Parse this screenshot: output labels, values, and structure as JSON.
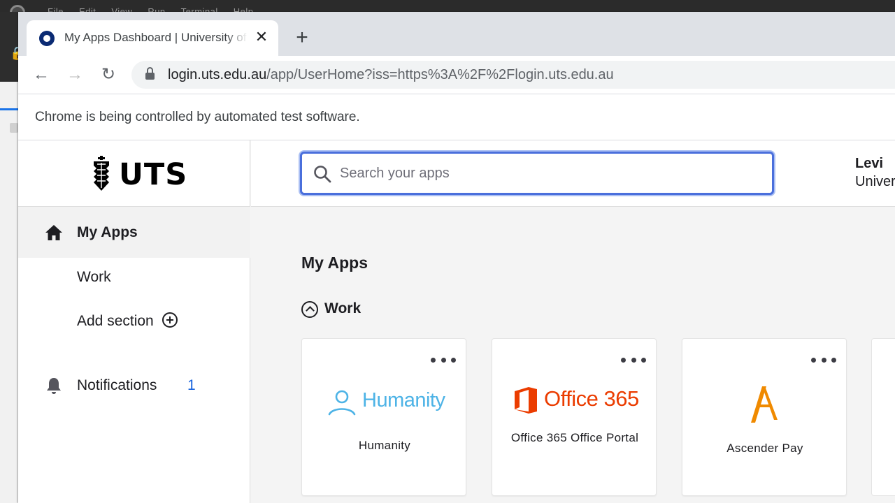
{
  "os": {
    "menu_items": [
      "File",
      "Edit",
      "View",
      "Run",
      "Terminal",
      "Help"
    ]
  },
  "browser": {
    "tab_title": "My Apps Dashboard | University of Technology Sydney",
    "url_host": "login.uts.edu.au",
    "url_path": "/app/UserHome?iss=https%3A%2F%2Flogin.uts.edu.au",
    "infobar_text": "Chrome is being controlled by automated test software."
  },
  "sidebar": {
    "logo_text": "UTS",
    "my_apps_label": "My Apps",
    "work_label": "Work",
    "add_section_label": "Add section",
    "notifications_label": "Notifications",
    "notifications_count": "1"
  },
  "header": {
    "search_placeholder": "Search your apps",
    "user_name": "Levi",
    "user_org": "University of Technology Sydney"
  },
  "main": {
    "title": "My Apps",
    "section_title": "Work",
    "apps": [
      {
        "label": "Humanity",
        "logo_text": "Humanity",
        "logo_color": "#4db3e6"
      },
      {
        "label": "Office 365 Office Portal",
        "logo_text": "Office 365",
        "logo_color": "#eb3c00"
      },
      {
        "label": "Ascender Pay",
        "logo_color": "#f08a00"
      }
    ]
  },
  "colors": {
    "accent": "#4a6fdc",
    "notification_count": "#1662dd",
    "favicon": "#0a2a73"
  }
}
